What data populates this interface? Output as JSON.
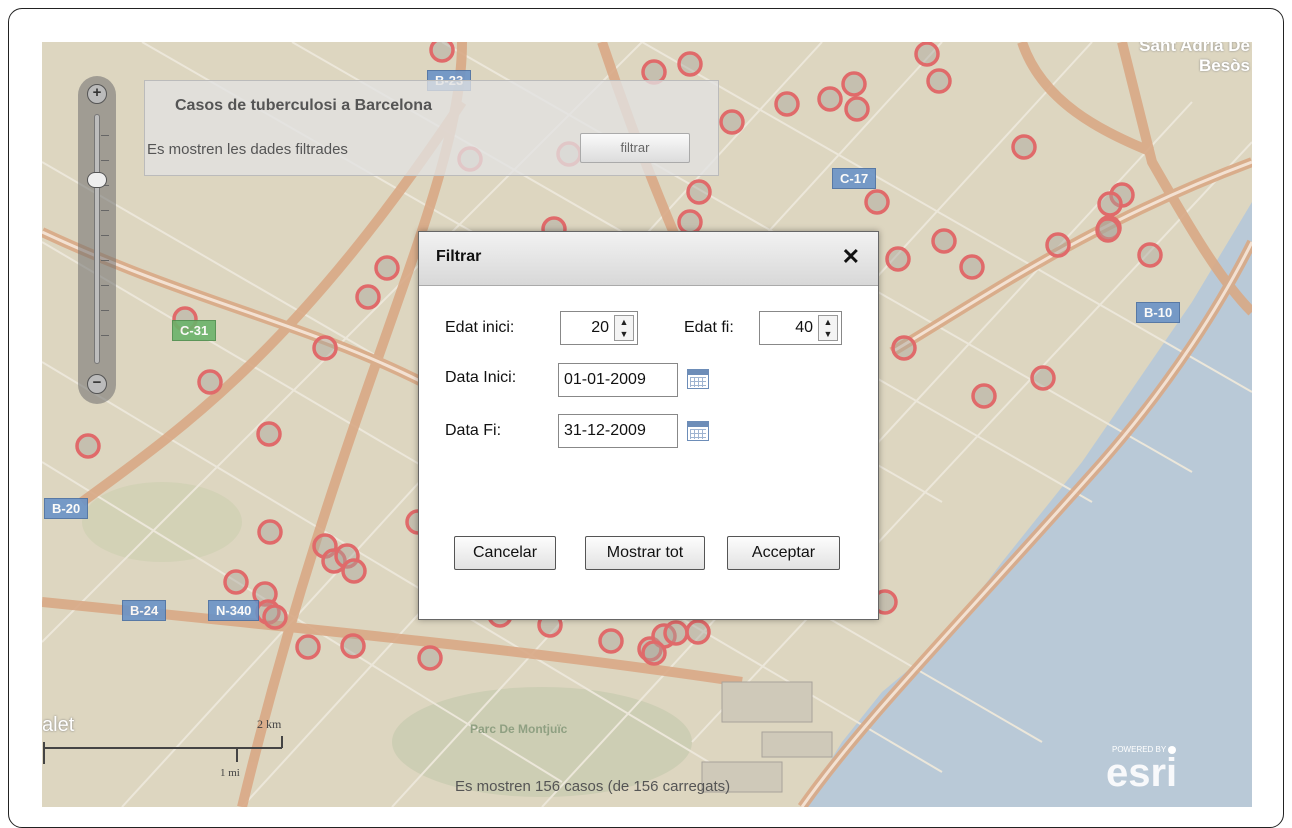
{
  "map": {
    "place_labels": [
      "Sant Adrià De Besòs",
      "Parc De Montjuïc",
      "alet"
    ],
    "road_shields": [
      "C-17",
      "B-10",
      "B-20",
      "B-24",
      "N-340",
      "C-31",
      "B-23"
    ],
    "status": "Es mostren 156 casos  (de 156 carregats)",
    "scale_km": "2 km",
    "scale_mi": "1 mi",
    "esri_powered": "POWERED BY",
    "esri_logo": "esri",
    "colors": {
      "land": "#ddd6c0",
      "sea": "#b9c9d7",
      "road": "#d9a986",
      "case_ring": "#e06a6a",
      "case_fill": "#a9a49b"
    }
  },
  "info_panel": {
    "title": "Casos de tuberculosi a Barcelona",
    "description": "Es mostren les dades filtrades",
    "filter_button": "filtrar"
  },
  "dialog": {
    "title": "Filtrar",
    "close": "✕",
    "age_start_label": "Edat inici:",
    "age_start_value": "20",
    "age_end_label": "Edat fi:",
    "age_end_value": "40",
    "date_start_label": "Data Inici:",
    "date_start_value": "01-01-2009",
    "date_end_label": "Data Fi:",
    "date_end_value": "31-12-2009",
    "cancel_button": "Cancelar",
    "show_all_button": "Mostrar tot",
    "accept_button": "Acceptar"
  }
}
